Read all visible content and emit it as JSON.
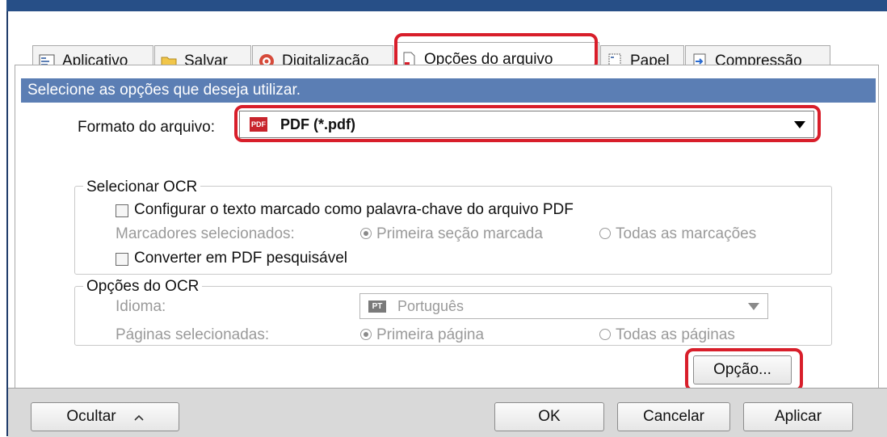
{
  "tabs": [
    {
      "label": "Aplicativo",
      "icon": "app-icon"
    },
    {
      "label": "Salvar",
      "icon": "folder-icon"
    },
    {
      "label": "Digitalização",
      "icon": "scan-icon"
    },
    {
      "label": "Opções do arquivo",
      "icon": "file-icon"
    },
    {
      "label": "Papel",
      "icon": "paper-icon"
    },
    {
      "label": "Compressão",
      "icon": "compress-icon"
    }
  ],
  "header": {
    "text": "Selecione as opções que deseja utilizar."
  },
  "format": {
    "label": "Formato do arquivo:",
    "value": "PDF (*.pdf)",
    "icon_text": "PDF"
  },
  "ocr_select": {
    "title": "Selecionar OCR",
    "keyword_checkbox": "Configurar o texto marcado como palavra-chave do arquivo PDF",
    "markers_label": "Marcadores selecionados:",
    "radio_first": "Primeira seção marcada",
    "radio_all": "Todas as marcações",
    "searchable_checkbox": "Converter em PDF pesquisável"
  },
  "ocr_options": {
    "title": "Opções do OCR",
    "language_label": "Idioma:",
    "language_value": "Português",
    "language_code": "PT",
    "pages_label": "Páginas selecionadas:",
    "radio_first_page": "Primeira página",
    "radio_all_pages": "Todas as páginas"
  },
  "option_button": "Opção...",
  "footer": {
    "hide": "Ocultar",
    "ok": "OK",
    "cancel": "Cancelar",
    "apply": "Aplicar"
  },
  "colors": {
    "highlight": "#d81e2a",
    "header": "#5b7eb4",
    "titlebar": "#274f87"
  }
}
